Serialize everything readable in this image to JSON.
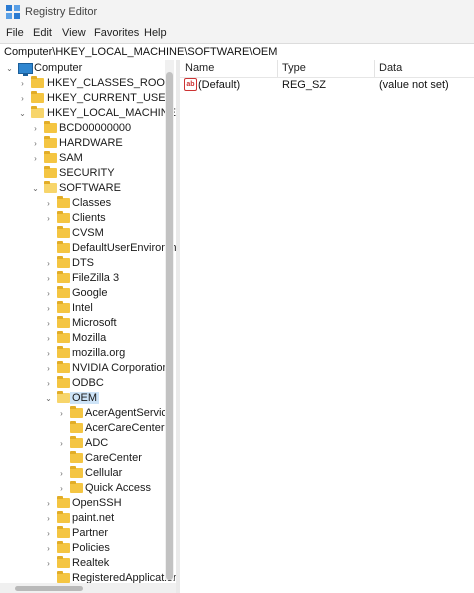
{
  "window": {
    "title": "Registry Editor",
    "icon": "registry-icon"
  },
  "menu": [
    "File",
    "Edit",
    "View",
    "Favorites",
    "Help"
  ],
  "address": "Computer\\HKEY_LOCAL_MACHINE\\SOFTWARE\\OEM",
  "tree": {
    "root": "Computer",
    "hkcr": "HKEY_CLASSES_ROOT",
    "hkcu": "HKEY_CURRENT_USER",
    "hklm": "HKEY_LOCAL_MACHINE",
    "hklm_children": [
      "BCD00000000",
      "HARDWARE",
      "SAM",
      "SECURITY",
      "SOFTWARE"
    ],
    "software_children": [
      "Classes",
      "Clients",
      "CVSM",
      "DefaultUserEnvironm",
      "DTS",
      "FileZilla 3",
      "Google",
      "Intel",
      "Microsoft",
      "Mozilla",
      "mozilla.org",
      "NVIDIA Corporation",
      "ODBC",
      "OEM"
    ],
    "oem_children": [
      "AcerAgentService",
      "AcerCareCenter",
      "ADC",
      "CareCenter",
      "Cellular",
      "Quick Access"
    ],
    "after_oem": [
      "OpenSSH",
      "paint.net",
      "Partner",
      "Policies",
      "Realtek",
      "RegisteredApplication"
    ]
  },
  "columns": {
    "name": "Name",
    "type": "Type",
    "data": "Data"
  },
  "values": [
    {
      "name": "(Default)",
      "type": "REG_SZ",
      "data": "(value not set)"
    }
  ]
}
